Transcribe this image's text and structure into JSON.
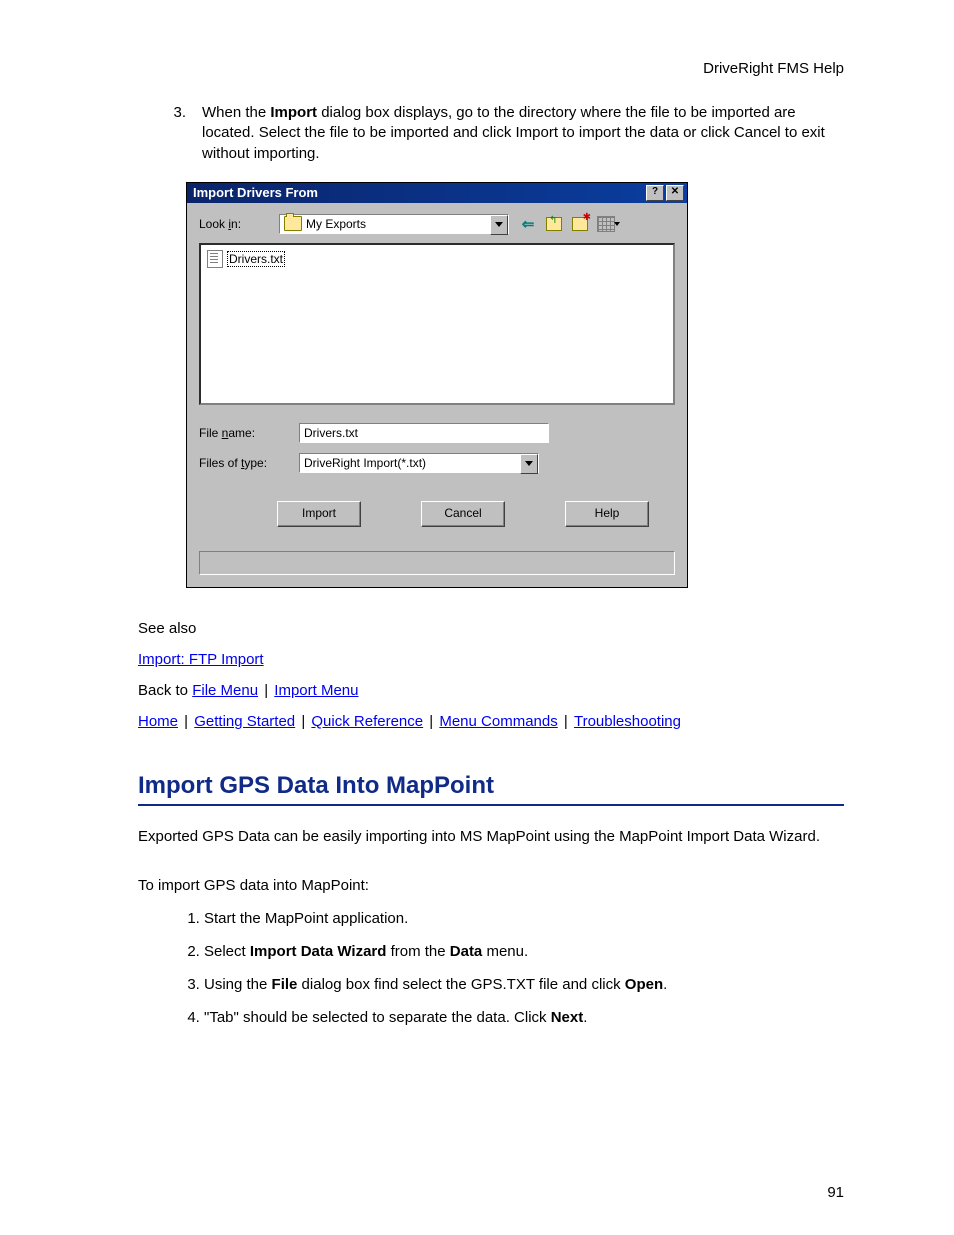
{
  "header": {
    "text": "DriveRight FMS Help"
  },
  "step3": {
    "number": "3.",
    "text_before": "When the ",
    "bold1": "Import",
    "text_after": " dialog box displays, go to the directory where the file to be imported are located. Select the file to be imported and click Import to import the data or click Cancel to exit without importing."
  },
  "dialog": {
    "title": "Import Drivers From",
    "lookin_label_pre": "Look ",
    "lookin_label_u": "i",
    "lookin_label_post": "n:",
    "lookin_value": "My Exports",
    "file_item": "Drivers.txt",
    "filename_label_pre": "File ",
    "filename_label_u": "n",
    "filename_label_post": "ame:",
    "filename_value": "Drivers.txt",
    "filetype_label_pre": "Files of ",
    "filetype_label_u": "t",
    "filetype_label_post": "ype:",
    "filetype_value": "DriveRight Import(*.txt)",
    "buttons": {
      "import": "Import",
      "cancel": "Cancel",
      "help": "Help"
    }
  },
  "seealso": {
    "label": "See also",
    "link1": "Import: FTP Import",
    "back_pre": "Back to ",
    "file_menu": "File Menu",
    "import_menu": "Import Menu"
  },
  "footer_links": {
    "home": "Home",
    "getting_started": "Getting Started",
    "quick_ref": "Quick Reference",
    "menu_cmds": "Menu Commands",
    "troubleshooting": "Troubleshooting"
  },
  "section2": {
    "heading": "Import GPS Data Into MapPoint",
    "intro": "Exported GPS Data can be easily importing into MS MapPoint using the MapPoint Import Data Wizard.",
    "lead": "To import GPS data into MapPoint:",
    "steps": {
      "s1": "Start the MapPoint application.",
      "s2_pre": "Select ",
      "s2_b1": "Import Data Wizard",
      "s2_mid": " from the ",
      "s2_b2": "Data",
      "s2_post": " menu.",
      "s3_pre": "Using the ",
      "s3_b1": "File",
      "s3_mid": " dialog box find select the GPS.TXT file and click ",
      "s3_b2": "Open",
      "s3_post": ".",
      "s4_pre": "\"Tab\" should be selected to separate the data. Click ",
      "s4_b1": "Next",
      "s4_post": "."
    }
  },
  "page_number": "91"
}
